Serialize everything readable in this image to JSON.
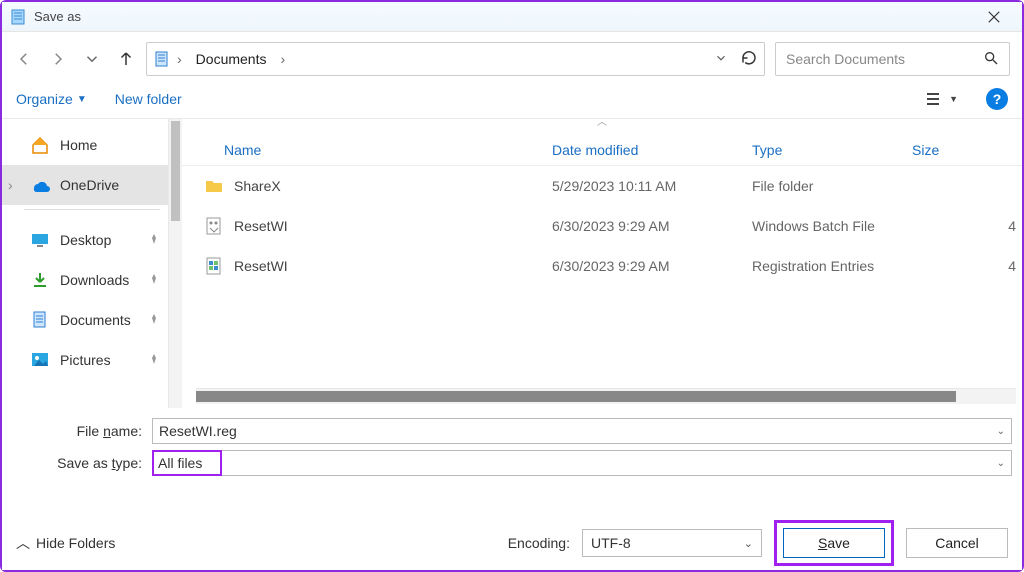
{
  "window": {
    "title": "Save as"
  },
  "nav": {
    "location": "Documents"
  },
  "search": {
    "placeholder": "Search Documents"
  },
  "toolbar": {
    "organize": "Organize",
    "new_folder": "New folder"
  },
  "columns": {
    "name": "Name",
    "date": "Date modified",
    "type": "Type",
    "size": "Size"
  },
  "sidebar": {
    "items": [
      {
        "label": "Home"
      },
      {
        "label": "OneDrive"
      },
      {
        "label": "Desktop"
      },
      {
        "label": "Downloads"
      },
      {
        "label": "Documents"
      },
      {
        "label": "Pictures"
      }
    ]
  },
  "files": [
    {
      "name": "ShareX",
      "date": "5/29/2023 10:11 AM",
      "type": "File folder",
      "size": ""
    },
    {
      "name": "ResetWI",
      "date": "6/30/2023 9:29 AM",
      "type": "Windows Batch File",
      "size": "4"
    },
    {
      "name": "ResetWI",
      "date": "6/30/2023 9:29 AM",
      "type": "Registration Entries",
      "size": "4"
    }
  ],
  "form": {
    "file_name_label": "File name:",
    "file_name_value": "ResetWI.reg",
    "save_type_label": "Save as type:",
    "save_type_value": "All files",
    "encoding_label": "Encoding:",
    "encoding_value": "UTF-8"
  },
  "buttons": {
    "save": "Save",
    "cancel": "Cancel",
    "hide_folders": "Hide Folders"
  }
}
